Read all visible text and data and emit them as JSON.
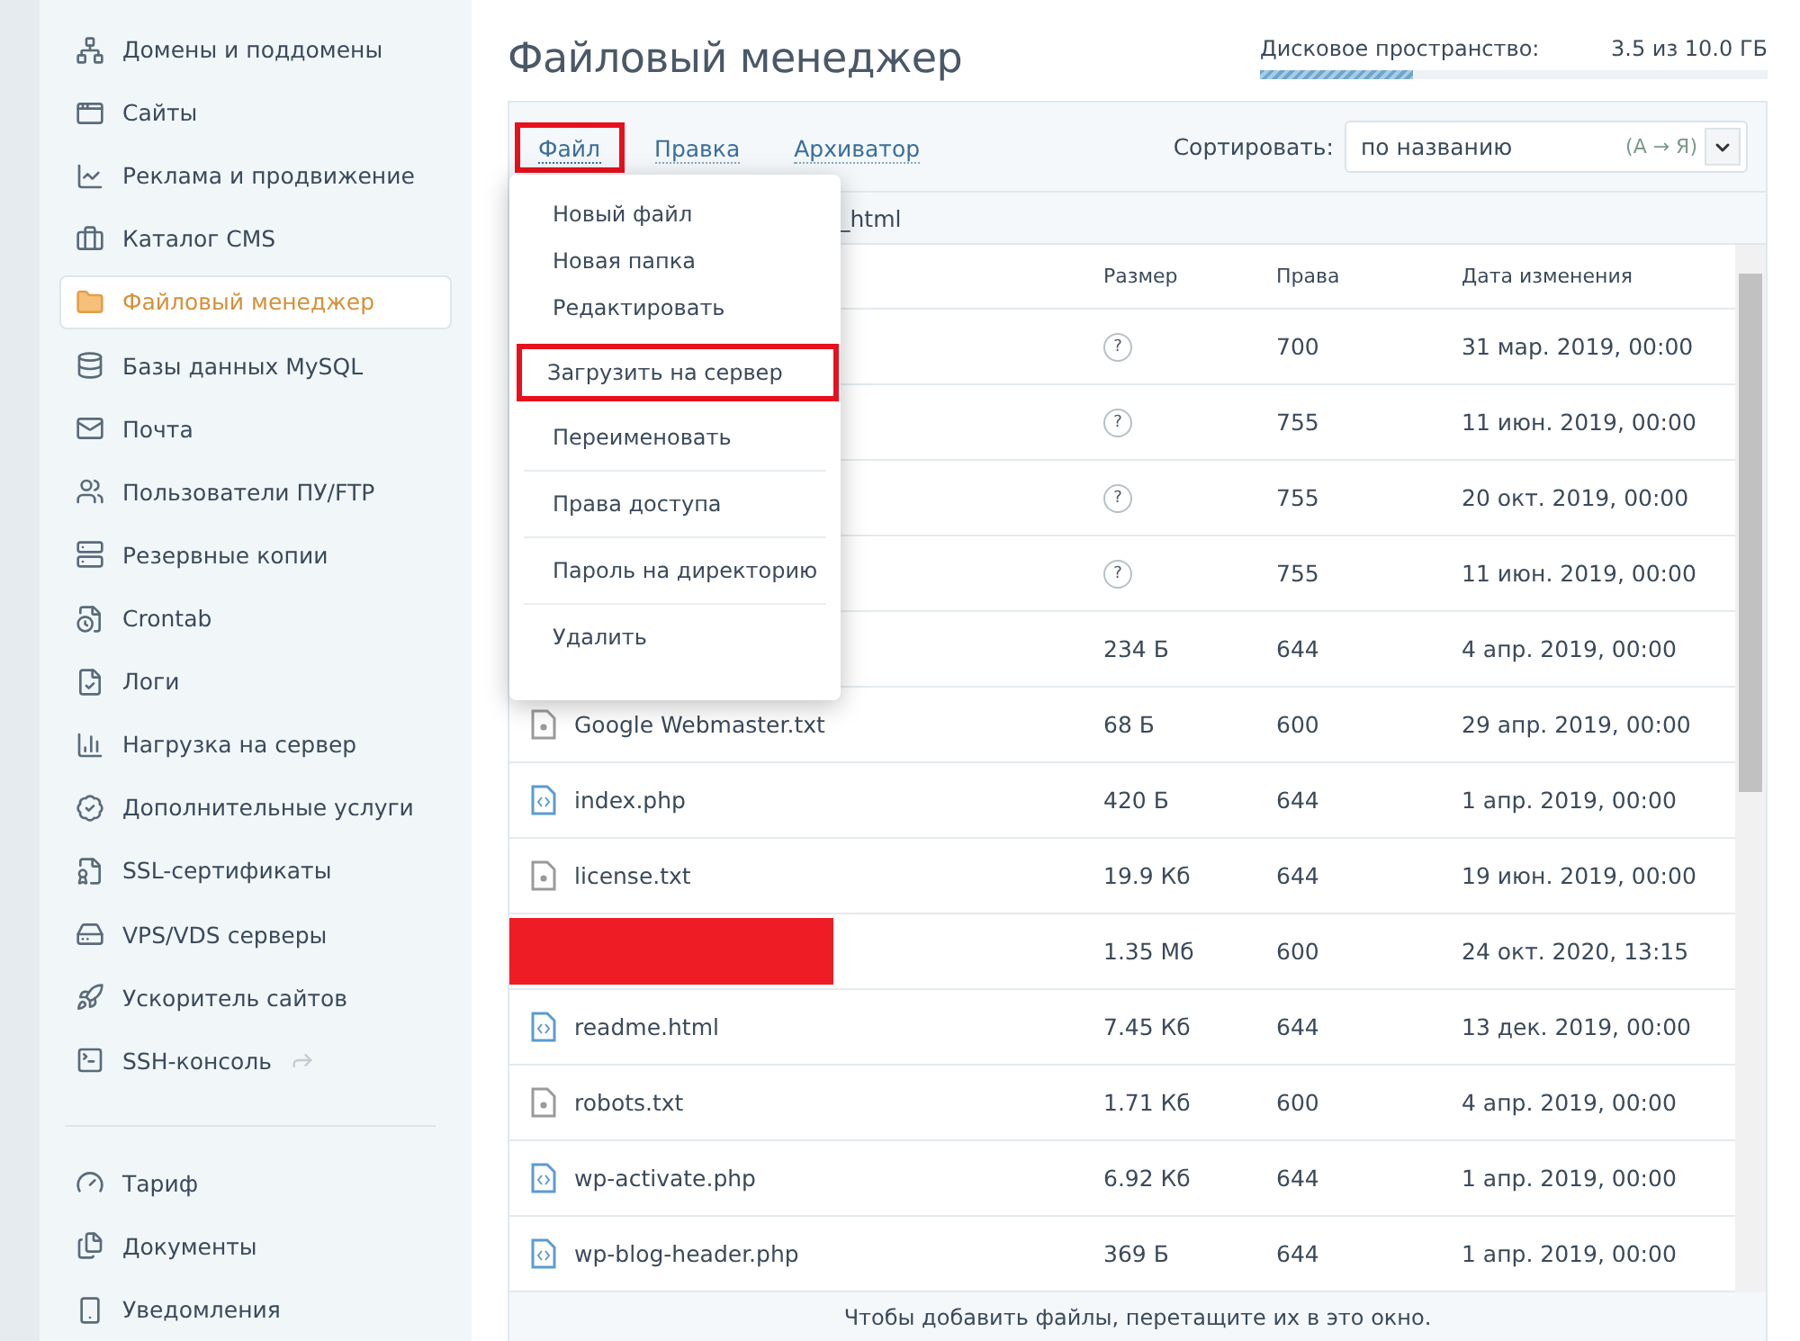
{
  "sidebar": {
    "items": [
      {
        "label": "Домены и поддомены",
        "selected": false
      },
      {
        "label": "Сайты",
        "selected": false
      },
      {
        "label": "Реклама и продвижение",
        "selected": false
      },
      {
        "label": "Каталог CMS",
        "selected": false
      },
      {
        "label": "Файловый менеджер",
        "selected": true
      },
      {
        "label": "Базы данных MySQL",
        "selected": false
      },
      {
        "label": "Почта",
        "selected": false
      },
      {
        "label": "Пользователи ПУ/FTP",
        "selected": false
      },
      {
        "label": "Резервные копии",
        "selected": false
      },
      {
        "label": "Crontab",
        "selected": false
      },
      {
        "label": "Логи",
        "selected": false
      },
      {
        "label": "Нагрузка на сервер",
        "selected": false
      },
      {
        "label": "Дополнительные услуги",
        "selected": false
      },
      {
        "label": "SSL-сертификаты",
        "selected": false
      },
      {
        "label": "VPS/VDS серверы",
        "selected": false
      },
      {
        "label": "Ускоритель сайтов",
        "selected": false
      },
      {
        "label": "SSH-консоль",
        "selected": false,
        "external": true
      }
    ],
    "footer_items": [
      {
        "label": "Тариф",
        "selected": false
      },
      {
        "label": "Документы",
        "selected": false
      },
      {
        "label": "Уведомления",
        "selected": false
      }
    ]
  },
  "title": "Файловый менеджер",
  "disk": {
    "label": "Дисковое пространство:",
    "value": "3.5 из 10.0 ГБ",
    "level": 0.3
  },
  "tabs": [
    {
      "label": "Файл",
      "selected": true,
      "highlighted": true
    },
    {
      "label": "Правка",
      "selected": false,
      "highlighted": false
    },
    {
      "label": "Архиватор",
      "selected": false,
      "highlighted": false
    }
  ],
  "sort": {
    "label": "Сортировать:",
    "value": "по названию",
    "order": "(А → Я)"
  },
  "breadcrumb": "_html",
  "menu": [
    {
      "label": "Новый файл",
      "highlighted": false,
      "divider": false
    },
    {
      "label": "Новая папка",
      "highlighted": false,
      "divider": false
    },
    {
      "label": "Редактировать",
      "highlighted": false,
      "divider": false
    },
    {
      "label": "Загрузить на сервер",
      "highlighted": true,
      "divider": false
    },
    {
      "label": "Переименовать",
      "highlighted": false,
      "divider": true
    },
    {
      "label": "Права доступа",
      "highlighted": false,
      "divider": true
    },
    {
      "label": "Пароль на директорию",
      "highlighted": false,
      "divider": true
    },
    {
      "label": "Удалить",
      "highlighted": false,
      "divider": false
    }
  ],
  "table": {
    "columns": [
      "Размер",
      "Права",
      "Дата изменения"
    ],
    "rows": [
      {
        "kind": "hidden",
        "size": "?",
        "size_unknown": true,
        "rights": "700",
        "date": "31 мар. 2019, 00:00"
      },
      {
        "kind": "hidden",
        "size": "?",
        "size_unknown": true,
        "rights": "755",
        "date": "11 июн. 2019, 00:00"
      },
      {
        "kind": "hidden",
        "size": "?",
        "size_unknown": true,
        "rights": "755",
        "date": "20 окт. 2019, 00:00"
      },
      {
        "kind": "hidden",
        "size": "?",
        "size_unknown": true,
        "rights": "755",
        "date": "11 июн. 2019, 00:00"
      },
      {
        "kind": "hidden",
        "size": "234 Б",
        "size_unknown": false,
        "rights": "644",
        "date": "4 апр. 2019, 00:00"
      },
      {
        "kind": "text",
        "name": "Google Webmaster.txt",
        "size": "68 Б",
        "size_unknown": false,
        "rights": "600",
        "date": "29 апр. 2019, 00:00"
      },
      {
        "kind": "code",
        "name": "index.php",
        "size": "420 Б",
        "size_unknown": false,
        "rights": "644",
        "date": "1 апр. 2019, 00:00"
      },
      {
        "kind": "text",
        "name": "license.txt",
        "size": "19.9 Кб",
        "size_unknown": false,
        "rights": "644",
        "date": "19 июн. 2019, 00:00"
      },
      {
        "kind": "redacted",
        "size": "1.35 Мб",
        "size_unknown": false,
        "rights": "600",
        "date": "24 окт. 2020, 13:15"
      },
      {
        "kind": "code",
        "name": "readme.html",
        "size": "7.45 Кб",
        "size_unknown": false,
        "rights": "644",
        "date": "13 дек. 2019, 00:00"
      },
      {
        "kind": "text",
        "name": "robots.txt",
        "size": "1.71 Кб",
        "size_unknown": false,
        "rights": "600",
        "date": "4 апр. 2019, 00:00"
      },
      {
        "kind": "code",
        "name": "wp-activate.php",
        "size": "6.92 Кб",
        "size_unknown": false,
        "rights": "644",
        "date": "1 апр. 2019, 00:00"
      },
      {
        "kind": "code",
        "name": "wp-blog-header.php",
        "size": "369 Б",
        "size_unknown": false,
        "rights": "644",
        "date": "1 апр. 2019, 00:00"
      }
    ]
  },
  "footer": "Чтобы добавить файлы, перетащите их в это окно."
}
